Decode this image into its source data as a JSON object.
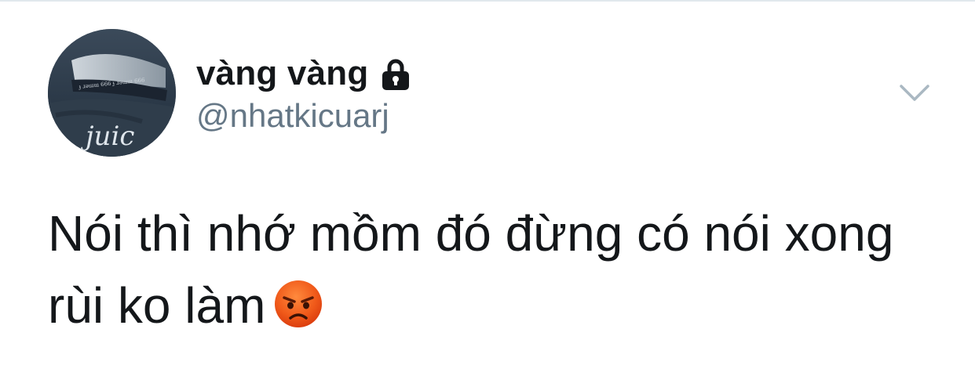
{
  "tweet": {
    "display_name": "vàng vàng",
    "handle": "@nhatkicuarj",
    "text": "Nói thì nhớ mồm đó đừng có nói xong rùi ko làm",
    "emoji": "angry-face-emoji",
    "avatar_text": "juic",
    "protected_icon": "lock-icon",
    "menu_icon": "chevron-down-icon"
  },
  "colors": {
    "name": "#14171a",
    "handle": "#657786",
    "caret": "#aab8c2",
    "background": "#ffffff"
  }
}
